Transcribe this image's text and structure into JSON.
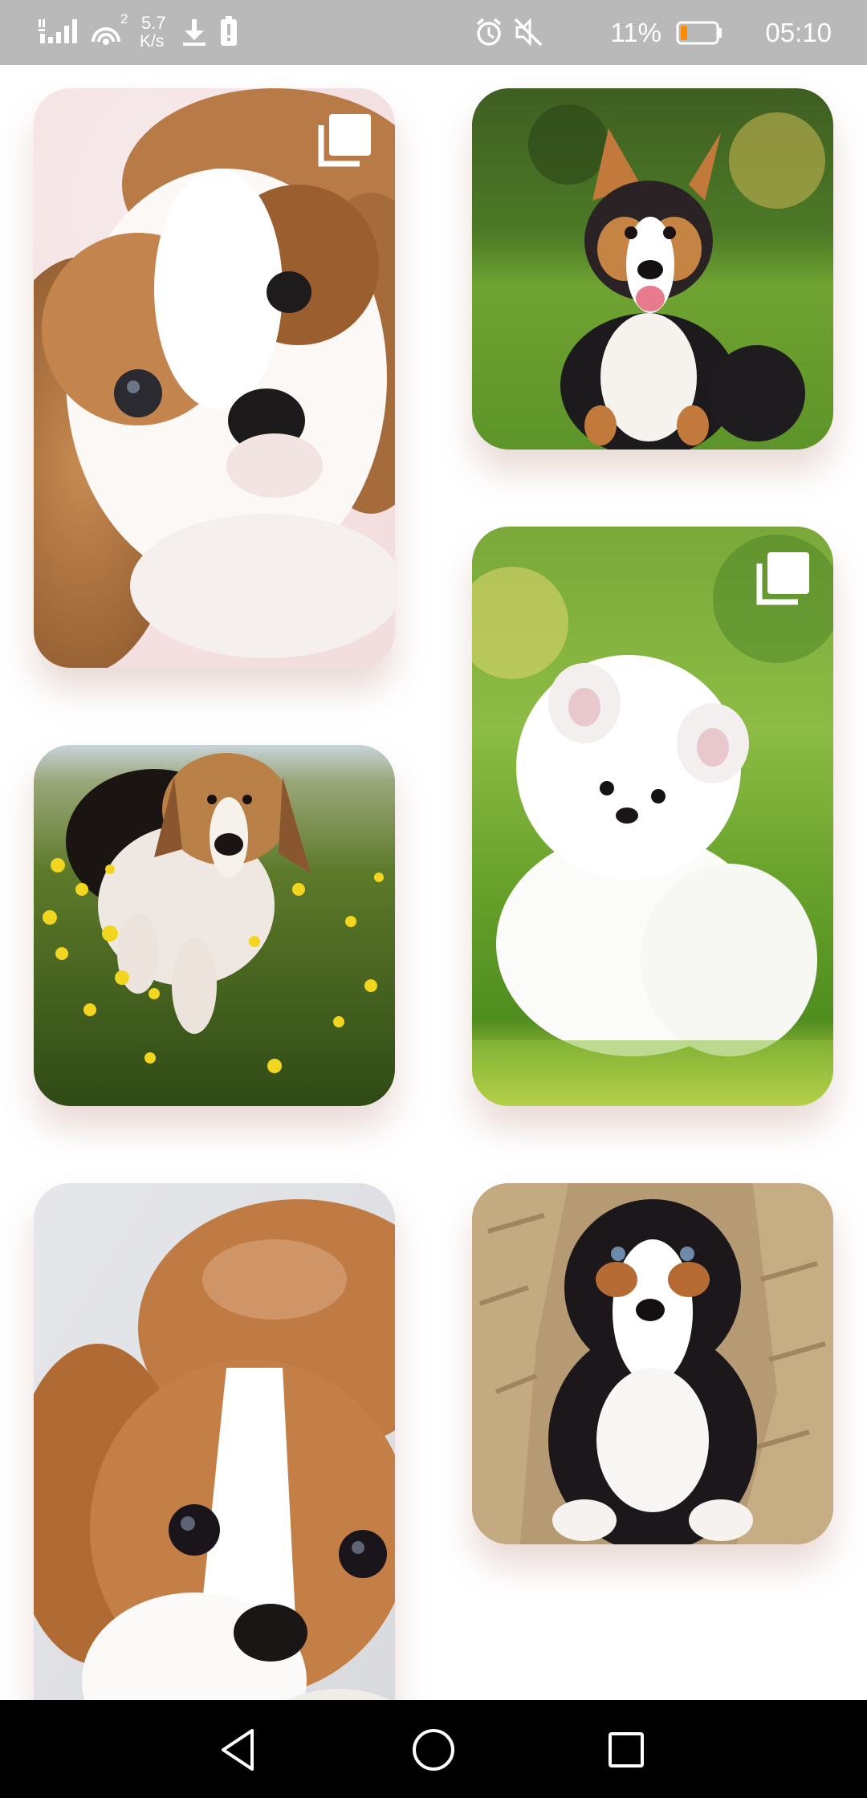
{
  "status_bar": {
    "network_speed_value": "5.7",
    "network_speed_unit": "K/s",
    "wifi_badge": "2",
    "battery_percent": "11%",
    "time": "05:10",
    "battery_color": "#ff8c00",
    "icons": [
      "signal-icon",
      "wifi-icon",
      "download-icon",
      "battery-alert-icon",
      "alarm-icon",
      "mute-icon",
      "battery-icon"
    ]
  },
  "gallery": {
    "cards": [
      {
        "subject": "Cavalier King Charles spaniel puppy close-up",
        "multiple_images": true
      },
      {
        "subject": "Tricolor corgi puppy on grass",
        "multiple_images": false
      },
      {
        "subject": "Beagle puppy walking through yellow flowers",
        "multiple_images": false
      },
      {
        "subject": "White Pomeranian puppy on grass",
        "multiple_images": true
      },
      {
        "subject": "Cavalier spaniel puppy lying down",
        "multiple_images": false
      },
      {
        "subject": "Bernese puppy in burlap sack",
        "multiple_images": false
      }
    ]
  },
  "nav_bar": {
    "buttons": [
      "back",
      "home",
      "recents"
    ]
  }
}
